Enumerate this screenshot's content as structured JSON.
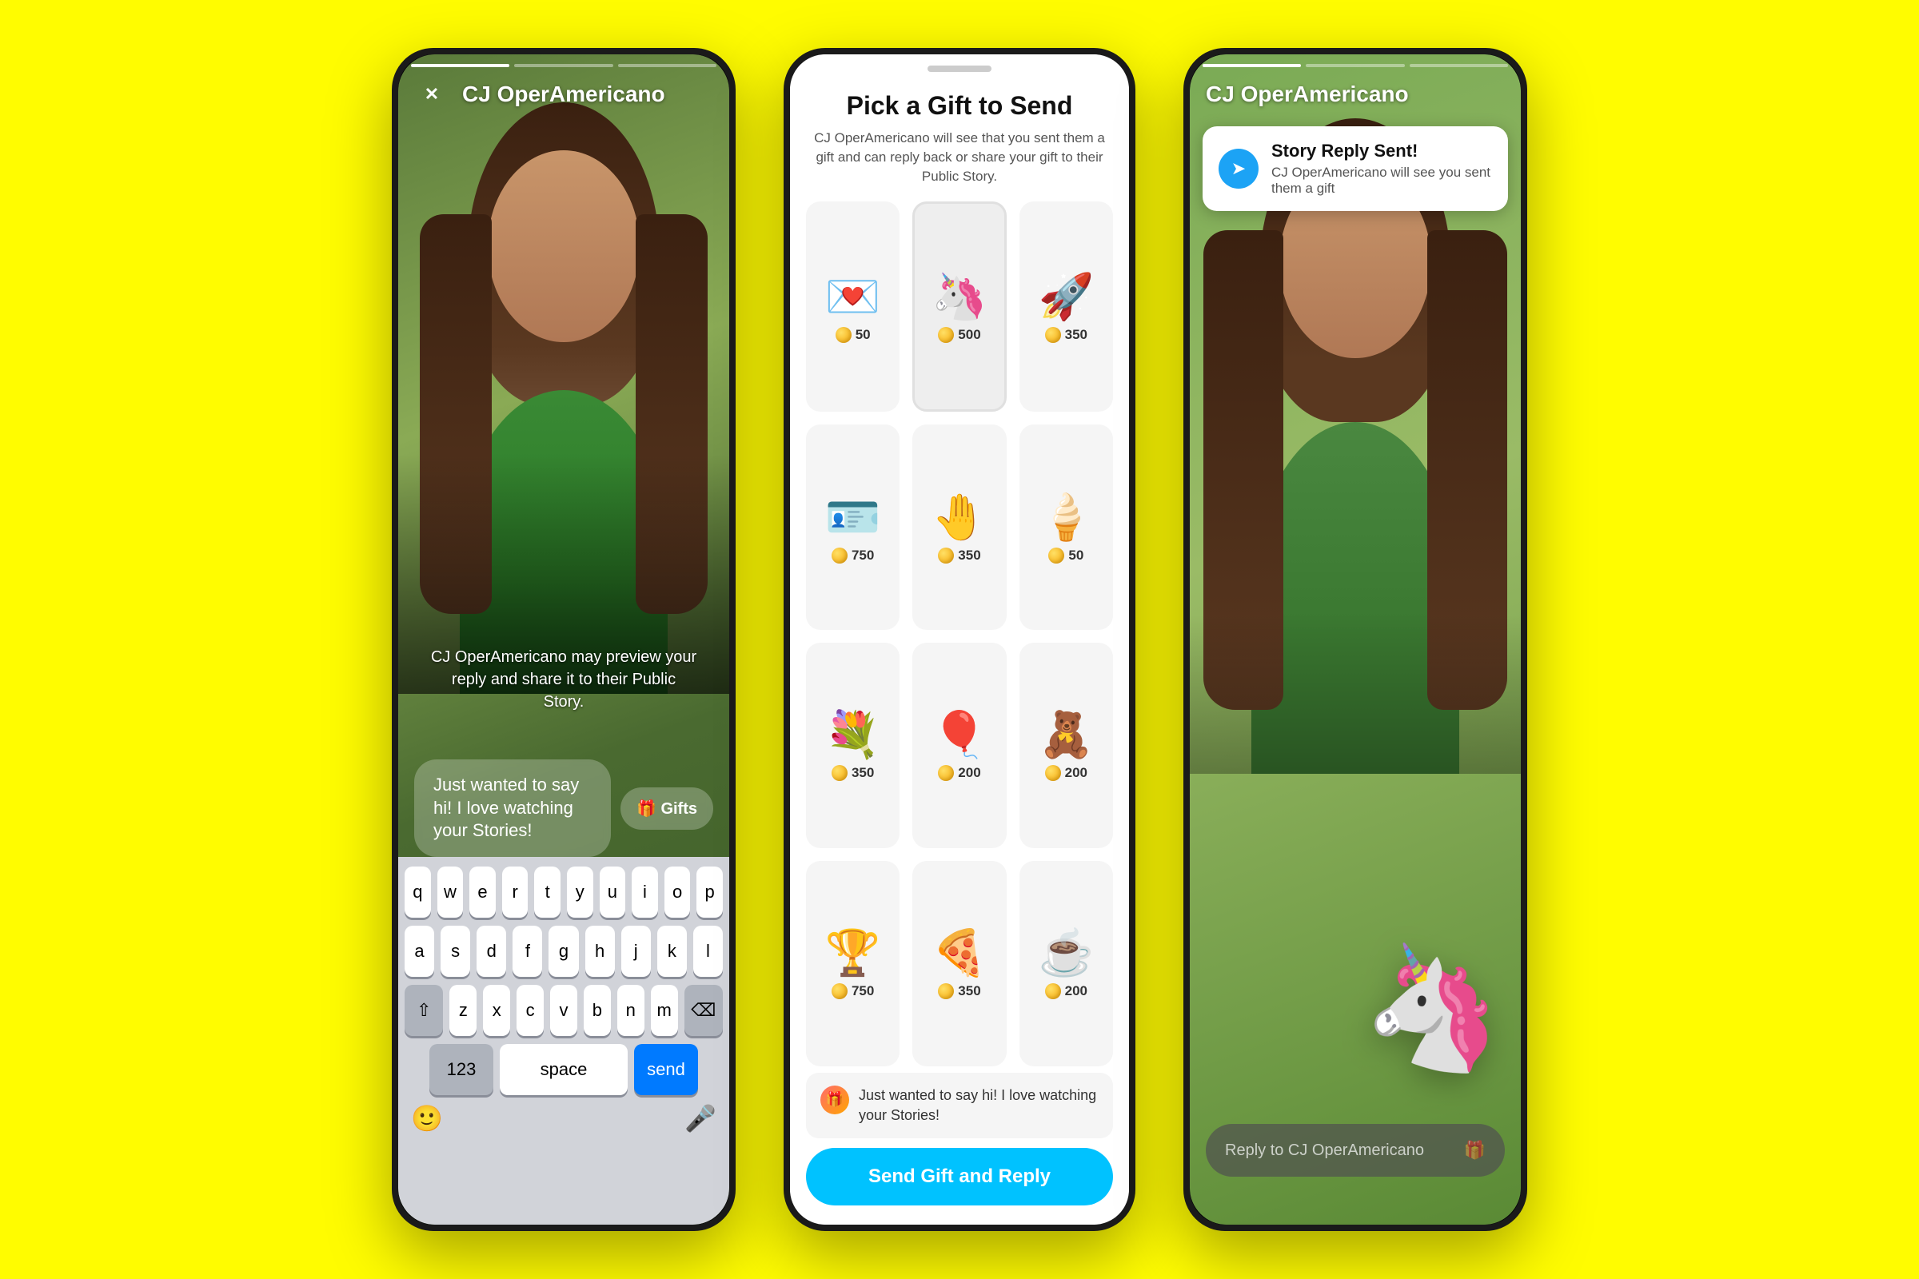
{
  "background_color": "#FFFC00",
  "phone1": {
    "username": "CJ OperAmericano",
    "close_label": "✕",
    "preview_text": "CJ OperAmericano may preview your reply and share it to their Public Story.",
    "reply_placeholder": "Just wanted to say hi! I love watching your Stories!",
    "gifts_label": "🎁 Gifts",
    "keyboard": {
      "row1": [
        "q",
        "w",
        "e",
        "r",
        "t",
        "y",
        "u",
        "i",
        "o",
        "p"
      ],
      "row2": [
        "a",
        "s",
        "d",
        "f",
        "g",
        "h",
        "j",
        "k",
        "l"
      ],
      "row3_special_left": "⇧",
      "row3": [
        "z",
        "x",
        "c",
        "v",
        "b",
        "n",
        "m"
      ],
      "row3_special_right": "⌫",
      "row4_num": "123",
      "row4_space": "space",
      "row4_send": "send",
      "emoji_icon": "🙂",
      "mic_icon": "🎤"
    }
  },
  "phone2": {
    "notch": true,
    "title": "Pick a Gift to Send",
    "subtitle": "CJ OperAmericano will see that you sent them a gift and can reply back or share your gift to their Public Story.",
    "gifts": [
      {
        "emoji": "💌",
        "cost": 50,
        "selected": false
      },
      {
        "emoji": "🦄",
        "cost": 500,
        "selected": true
      },
      {
        "emoji": "🚀",
        "cost": 350,
        "selected": false
      },
      {
        "emoji": "🪪",
        "cost": 750,
        "selected": false
      },
      {
        "emoji": "🤚",
        "cost": 350,
        "selected": false
      },
      {
        "emoji": "🍦",
        "cost": 50,
        "selected": false
      },
      {
        "emoji": "💐",
        "cost": 350,
        "selected": false
      },
      {
        "emoji": "🎈",
        "cost": 200,
        "selected": false
      },
      {
        "emoji": "🧸",
        "cost": 200,
        "selected": false
      },
      {
        "emoji": "🏆",
        "cost": 750,
        "selected": false
      },
      {
        "emoji": "🍕",
        "cost": 350,
        "selected": false
      },
      {
        "emoji": "☕",
        "cost": 200,
        "selected": false
      }
    ],
    "message_text": "Just wanted to say hi! I love watching your Stories!",
    "send_button_label": "Send Gift and Reply"
  },
  "phone3": {
    "username": "CJ OperAmericano",
    "notification": {
      "title": "Story Reply Sent!",
      "subtitle": "CJ OperAmericano will see you sent them a gift"
    },
    "unicorn_emoji": "🦄",
    "reply_placeholder": "Reply to CJ OperAmericano",
    "reply_icon": "🎁"
  }
}
